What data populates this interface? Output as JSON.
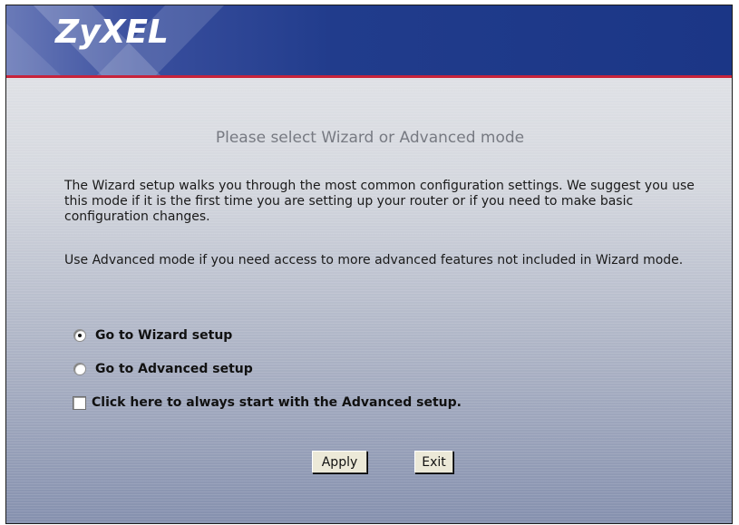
{
  "header": {
    "logo_text": "ZyXEL",
    "accent_color": "#1b3686",
    "stripe_color": "#c8233b"
  },
  "main": {
    "title": "Please select Wizard or Advanced mode",
    "paragraph1": "The Wizard setup walks you through the most common configuration settings. We suggest you use this mode if it is the first time you are setting up your router or if you need to make basic configuration changes.",
    "paragraph2": "Use Advanced mode if you need access to more advanced features not included in Wizard mode.",
    "options": [
      {
        "label": "Go to Wizard setup",
        "selected": true
      },
      {
        "label": "Go to Advanced setup",
        "selected": false
      }
    ],
    "checkbox": {
      "label": "Click here to always start with the Advanced setup.",
      "checked": false
    }
  },
  "buttons": {
    "apply_label": "Apply",
    "exit_label": "Exit"
  }
}
